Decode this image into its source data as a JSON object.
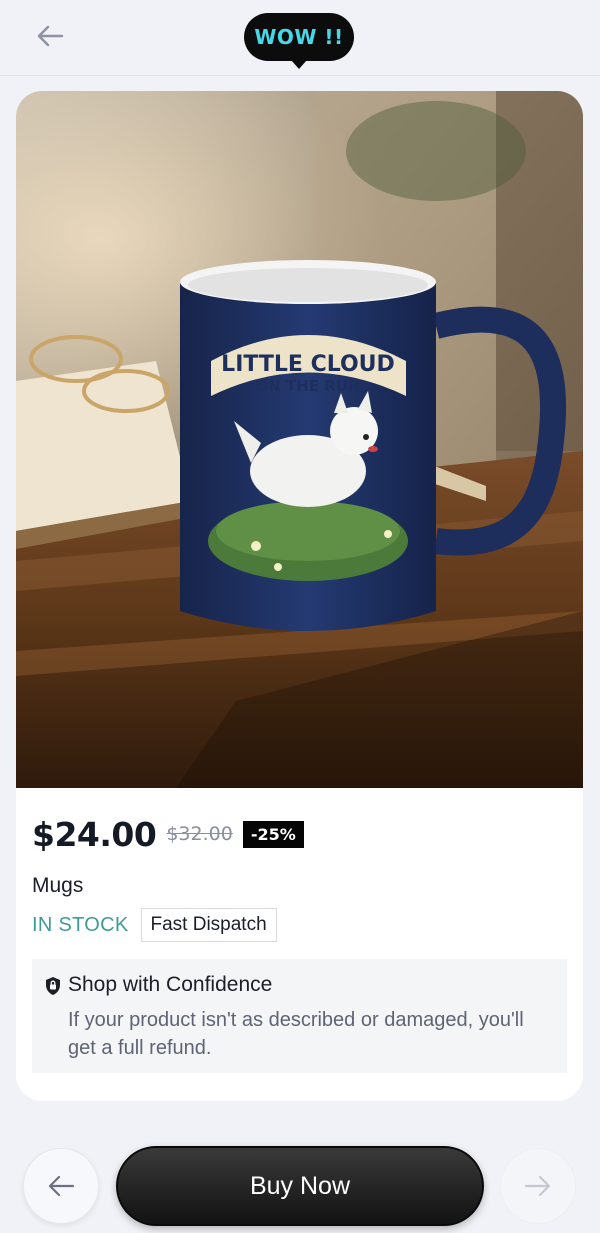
{
  "header": {
    "logo_text": "WOW !!",
    "back_icon": "arrow-left-icon"
  },
  "product": {
    "image_alt": "Navy mug printed with a running white terrier",
    "mug_print": {
      "line1": "LITTLE CLOUD",
      "line2": "ON THE RUN"
    },
    "price": "$24.00",
    "old_price": "$32.00",
    "discount": "-25%",
    "category": "Mugs",
    "stock_status": "IN STOCK",
    "dispatch_badge": "Fast Dispatch"
  },
  "confidence": {
    "icon": "shield-lock-icon",
    "title": "Shop with Confidence",
    "body": "If your product isn't as described or damaged, you'll get a full refund."
  },
  "footer": {
    "prev_icon": "arrow-left-icon",
    "buy_label": "Buy Now",
    "next_icon": "arrow-right-icon"
  },
  "colors": {
    "background": "#f1f2f7",
    "logo_bg": "#0c0c0c",
    "logo_text": "#47d8e8",
    "in_stock": "#3f9b99",
    "mug": "#1e2f5e",
    "buy_button": "#1a1a1a"
  }
}
